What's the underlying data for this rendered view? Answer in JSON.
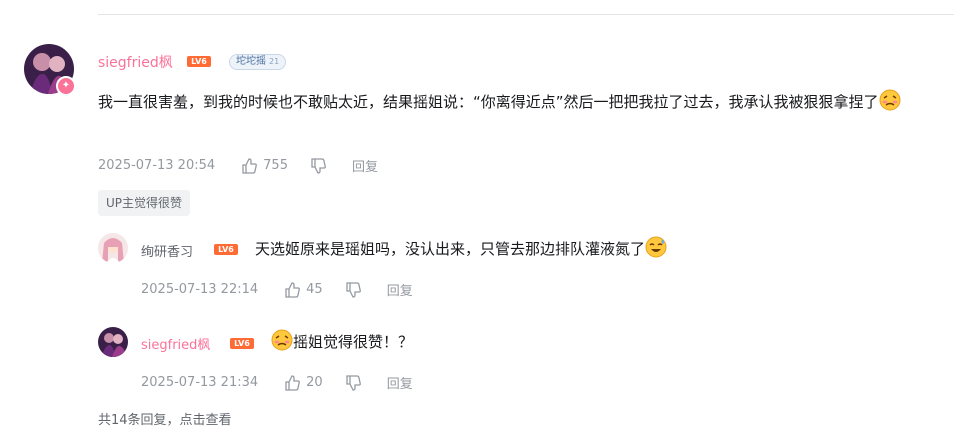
{
  "colors": {
    "username": "#fb7299",
    "meta": "#9499a0",
    "level_badge": "#ff6b35"
  },
  "main_comment": {
    "username": "siegfried枫",
    "level": "LV6",
    "fan_badge": {
      "name": "坨坨摇",
      "level": "21"
    },
    "text": "我一直很害羞，到我的时候也不敢贴太近，结果摇姐说：“你离得近点”然后一把把我拉了过去，我承认我被狠狠拿捏了",
    "emoji": "shy-face-emoji",
    "time": "2025-07-13 20:54",
    "likes": "755",
    "reply_label": "回复",
    "up_tag": "UP主觉得很赞"
  },
  "replies": [
    {
      "username": "绚研香习",
      "level": "LV6",
      "text": "天选姬原来是瑶姐吗，没认出来，只管去那边排队灌液氮了",
      "emoji": "sweat-laugh-emoji",
      "time": "2025-07-13 22:14",
      "likes": "45",
      "reply_label": "回复"
    },
    {
      "username": "siegfried枫",
      "level": "LV6",
      "text": "摇姐觉得很赞！？",
      "emoji": "shy-face-emoji",
      "time": "2025-07-13 21:34",
      "likes": "20",
      "reply_label": "回复"
    }
  ],
  "footer": {
    "more_replies": "共14条回复，点击查看"
  }
}
